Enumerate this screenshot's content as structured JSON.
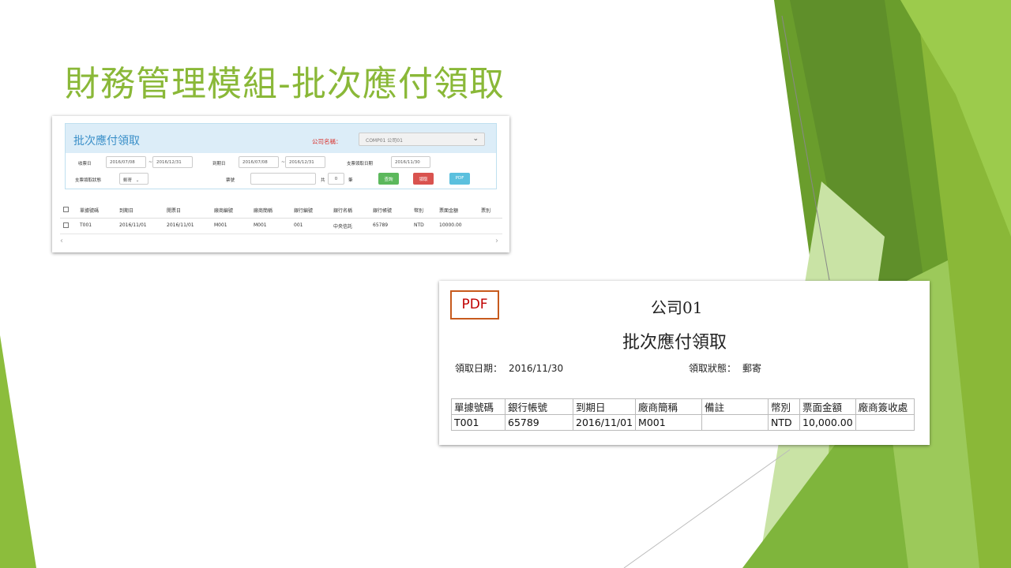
{
  "slide": {
    "title": "財務管理模組-批次應付領取",
    "accent": "#8ab838"
  },
  "form": {
    "title": "批次應付領取",
    "company_label": "公司名稱：",
    "company_value": "COMP01 公司01",
    "receipt_date_label": "收票日",
    "receipt_date_from": "2016/07/08",
    "receipt_date_to": "2016/12/31",
    "due_date_label": "到期日",
    "due_date_from": "2016/07/08",
    "due_date_to": "2016/12/31",
    "check_pickup_date_label": "支票領取日期",
    "check_pickup_date": "2016/11/30",
    "pickup_status_label": "支票領取狀態",
    "pickup_status_value": "郵寄",
    "ticket_no_label": "票號",
    "ticket_no_value": "",
    "total_prefix": "共",
    "total_count": "0",
    "total_suffix": "筆",
    "query_button": "查詢",
    "pickup_button": "領取",
    "pdf_button": "PDF",
    "table": {
      "headers": [
        "單據號碼",
        "到期日",
        "開票日",
        "廠商編號",
        "廠商簡稱",
        "銀行編號",
        "銀行名稱",
        "銀行帳號",
        "幣別",
        "票面金額",
        "票別"
      ],
      "rows": [
        [
          "T001",
          "2016/11/01",
          "2016/11/01",
          "M001",
          "M001",
          "001",
          "中央信託",
          "65789",
          "NTD",
          "10000.00",
          ""
        ]
      ]
    },
    "scroll_left": "‹",
    "scroll_right": "›"
  },
  "pdf": {
    "badge": "PDF",
    "company": "公司01",
    "title": "批次應付領取",
    "pickup_date_label": "領取日期：",
    "pickup_date": "2016/11/30",
    "pickup_status_label": "領取狀態：",
    "pickup_status": "郵寄",
    "table": {
      "headers": [
        "單據號碼",
        "銀行帳號",
        "到期日",
        "廠商簡稱",
        "備註",
        "幣別",
        "票面金額",
        "廠商簽收處"
      ],
      "rows": [
        [
          "T001",
          "65789",
          "2016/11/01",
          "M001",
          "",
          "NTD",
          "10,000.00",
          ""
        ]
      ]
    }
  }
}
